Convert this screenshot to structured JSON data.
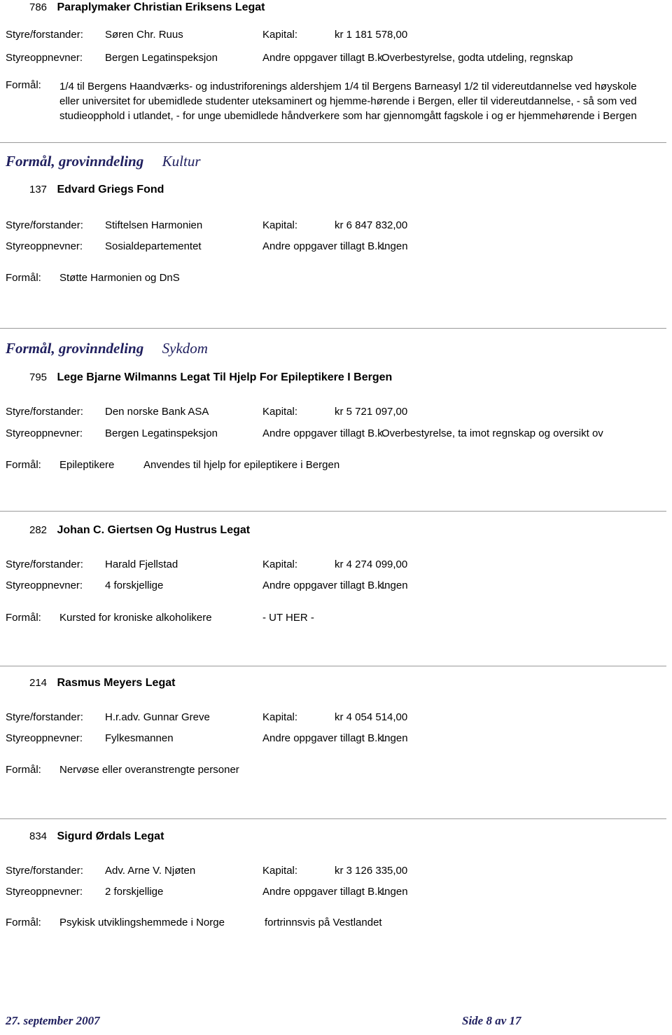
{
  "document": {
    "labels": {
      "styre": "Styre/forstander:",
      "styreoppnevner": "Styreoppnevner:",
      "kapital": "Kapital:",
      "andre_oppgaver": "Andre oppgaver tillagt B.k.",
      "formal": "Formål:",
      "section_key": "Formål, grovinndeling"
    },
    "accent_color": "#20205f",
    "rule_color": "#9a9a9a"
  },
  "entry_786": {
    "number": "786",
    "title": "Paraplymaker Christian Eriksens Legat",
    "styre_value": "Søren Chr. Ruus",
    "kapital_value": "kr 1 181 578,00",
    "styreoppnevner_value": "Bergen Legatinspeksjon",
    "andre_oppgaver_value": "Overbestyrelse, godta utdeling, regnskap",
    "formal_text": "1/4 til Bergens Haandværks- og industriforenings aldershjem    1/4 til Bergens Barneasyl    1/2 til videreutdannelse ved høyskole eller universitet for ubemidlede studenter uteksaminert og hjemme-hørende i Bergen, eller til videreutdannelse, - så som ved studieopphold i utlandet, - for unge ubemidlede håndverkere som har gjennomgått fagskole i og er hjemmehørende i Bergen"
  },
  "section_kultur": {
    "key": "Formål, grovinndeling",
    "value": "Kultur"
  },
  "entry_137": {
    "number": "137",
    "title": "Edvard Griegs Fond",
    "styre_value": "Stiftelsen Harmonien",
    "kapital_value": "kr 6 847 832,00",
    "styreoppnevner_value": "Sosialdepartementet",
    "andre_oppgaver_value": "Ingen",
    "formal_text": "Støtte Harmonien og DnS"
  },
  "section_sykdom": {
    "key": "Formål, grovinndeling",
    "value": "Sykdom"
  },
  "entry_795": {
    "number": "795",
    "title": "Lege Bjarne Wilmanns Legat Til Hjelp For Epileptikere I Bergen",
    "styre_value": "Den norske Bank ASA",
    "kapital_value": "kr 5 721 097,00",
    "styreoppnevner_value": "Bergen Legatinspeksjon",
    "andre_oppgaver_value": "Overbestyrelse, ta imot regnskap og oversikt ov",
    "formal_a": "Epileptikere",
    "formal_b": "Anvendes til hjelp for epileptikere i Bergen"
  },
  "entry_282": {
    "number": "282",
    "title": "Johan C. Giertsen Og Hustrus Legat",
    "styre_value": "Harald Fjellstad",
    "kapital_value": "kr 4 274 099,00",
    "styreoppnevner_value": "4 forskjellige",
    "andre_oppgaver_value": "Ingen",
    "formal_a": "Kursted for kroniske alkoholikere",
    "formal_b": "- UT HER -"
  },
  "entry_214": {
    "number": "214",
    "title": "Rasmus Meyers Legat",
    "styre_value": "H.r.adv. Gunnar Greve",
    "kapital_value": "kr 4 054 514,00",
    "styreoppnevner_value": "Fylkesmannen",
    "andre_oppgaver_value": "Ingen",
    "formal_a": "Nervøse eller overanstrengte personer",
    "formal_b": ""
  },
  "entry_834": {
    "number": "834",
    "title": "Sigurd Ørdals Legat",
    "styre_value": "Adv. Arne V. Njøten",
    "kapital_value": "kr 3 126 335,00",
    "styreoppnevner_value": "2 forskjellige",
    "andre_oppgaver_value": "Ingen",
    "formal_a": "Psykisk utviklingshemmede i Norge",
    "formal_b": "fortrinnsvis på Vestlandet"
  },
  "footer": {
    "date": "27. september 2007",
    "page": "Side 8 av 17"
  }
}
